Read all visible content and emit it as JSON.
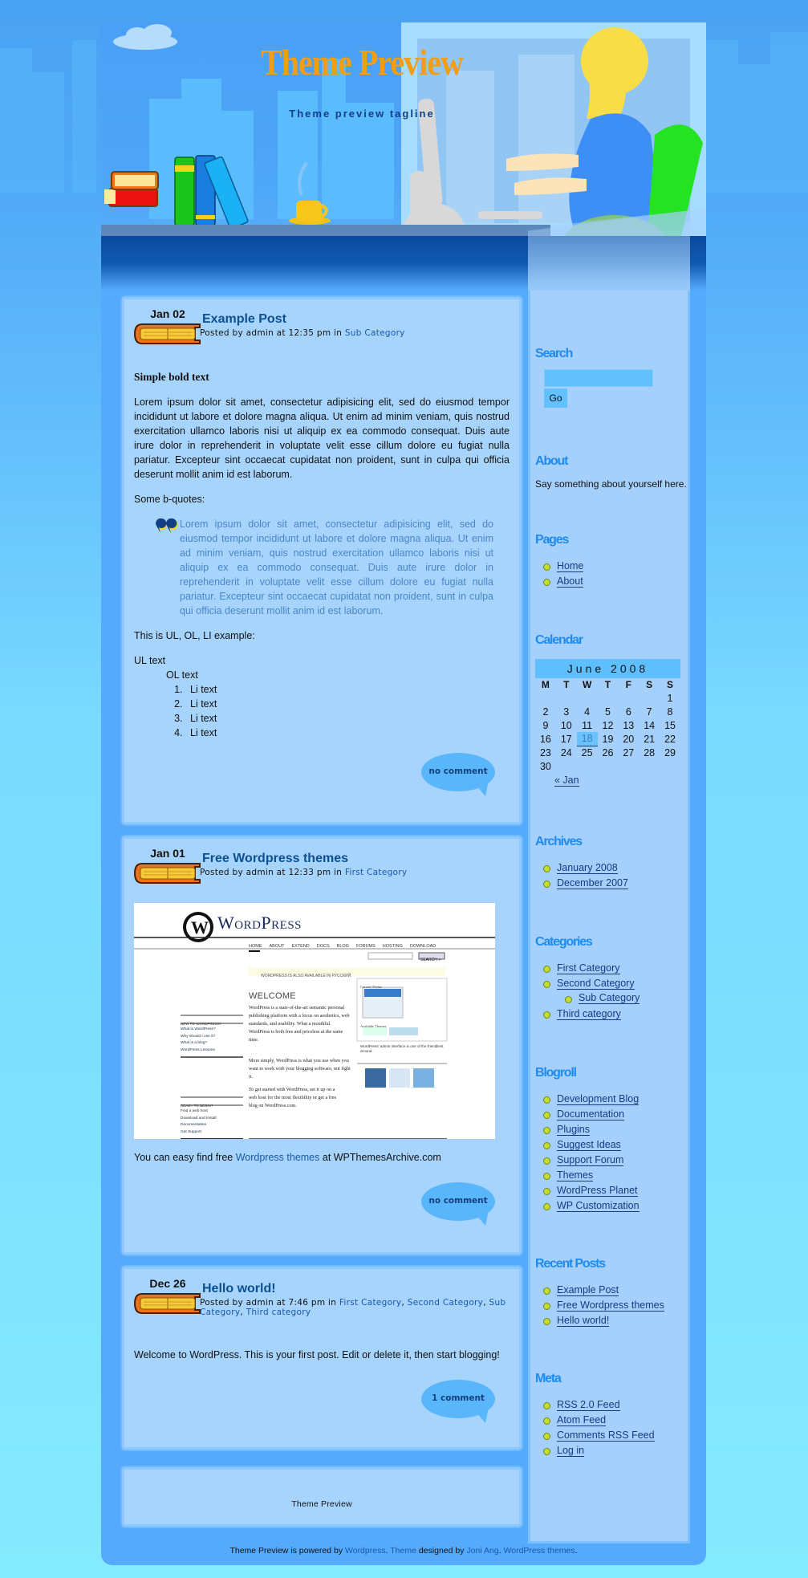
{
  "header": {
    "title": "Theme Preview",
    "tagline": "Theme preview tagline"
  },
  "posts": [
    {
      "date": "Jan 02",
      "title": "Example Post",
      "meta_prefix": "Posted by admin at 12:35 pm in ",
      "categories": [
        "Sub Category"
      ],
      "bold_heading": "Simple bold text",
      "paragraph": "Lorem ipsum dolor sit amet, consectetur adipisicing elit, sed do eiusmod tempor incididunt ut labore et dolore magna aliqua. Ut enim ad minim veniam, quis nostrud exercitation ullamco laboris nisi ut aliquip ex ea commodo consequat. Duis aute irure dolor in reprehenderit in voluptate velit esse cillum dolore eu fugiat nulla pariatur. Excepteur sint occaecat cupidatat non proident, sunt in culpa qui officia deserunt mollit anim id est laborum.",
      "bquote_intro": "Some b-quotes:",
      "blockquote": "Lorem ipsum dolor sit amet, consectetur adipisicing elit, sed do eiusmod tempor incididunt ut labore et dolore magna aliqua. Ut enim ad minim veniam, quis nostrud exercitation ullamco laboris nisi ut aliquip ex ea commodo consequat. Duis aute irure dolor in reprehenderit in voluptate velit esse cillum dolore eu fugiat nulla pariatur. Excepteur sint occaecat cupidatat non proident, sunt in culpa qui officia deserunt mollit anim id est laborum.",
      "list_intro": "This is UL, OL, LI example:",
      "ul_text": "UL text",
      "ol_text": "OL text",
      "li_items": [
        "Li text",
        "Li text",
        "Li text",
        "Li text"
      ],
      "comments": "no comment"
    },
    {
      "date": "Jan 01",
      "title": "Free Wordpress themes",
      "meta_prefix": "Posted by admin at 12:33 pm in ",
      "categories": [
        "First Category"
      ],
      "image": {
        "logo_text": "WordPress",
        "nav": [
          "HOME",
          "ABOUT",
          "EXTEND",
          "DOCS",
          "BLOG",
          "FORUMS",
          "HOSTING",
          "DOWNLOAD"
        ],
        "search_button": "SEARCH »",
        "notice": "WORDPRESS IS ALSO AVAILABLE IN РУССКИЙ.",
        "welcome": "WELCOME",
        "new_heading": "NEW TO WORDPRESS?",
        "new_links": [
          "What is WordPress?",
          "Why should I use it?",
          "What is a blog?",
          "WordPress Lessons"
        ],
        "begin_heading": "READY TO BEGIN?",
        "begin_links": [
          "Find a web host",
          "Download and Install",
          "Documentation",
          "Get Support"
        ],
        "para1": "WordPress is a state-of-the-art semantic personal publishing platform with a focus on aesthetics, web standards, and usability. What a mouthful. WordPress is both free and priceless at the same time.",
        "para2": "More simply, WordPress is what you use when you want to work with your blogging software, not fight it.",
        "para3": "To get started with WordPress, set it up on a web host for the most flexibility or get a free blog on WordPress.com.",
        "current_theme": "Current Theme",
        "available_themes": "Available Themes",
        "caption": "WordPress' admin interface is one of the friendliest around."
      },
      "text_before": "You can easy find free ",
      "link_text": "Wordpress themes",
      "text_after": " at WPThemesArchive.com",
      "comments": "no comment"
    },
    {
      "date": "Dec 26",
      "title": "Hello world!",
      "meta_prefix": "Posted by admin at 7:46 pm in ",
      "categories": [
        "First Category",
        "Second Category",
        "Sub Category",
        "Third category"
      ],
      "paragraph": "Welcome to WordPress. This is your first post. Edit or delete it, then start blogging!",
      "comments": "1 comment"
    }
  ],
  "footer_box": {
    "label": "Theme Preview"
  },
  "credits": {
    "prefix": "Theme Preview is powered by ",
    "wordpress": "Wordpress",
    "sep1": ". ",
    "theme": "Theme",
    "designed": " designed by ",
    "author": "Joni Ang",
    "sep2": ". ",
    "themes_link": "WordPress themes",
    "end": "."
  },
  "sidebar": {
    "search": {
      "title": "Search",
      "input_value": "",
      "button": "Go"
    },
    "about": {
      "title": "About",
      "text": "Say something about yourself here."
    },
    "pages": {
      "title": "Pages",
      "items": [
        "Home",
        "About"
      ]
    },
    "calendar": {
      "title": "Calendar",
      "caption": "June 2008",
      "weekdays": [
        "M",
        "T",
        "W",
        "T",
        "F",
        "S",
        "S"
      ],
      "weeks": [
        [
          "",
          "",
          "",
          "",
          "",
          "",
          "1"
        ],
        [
          "2",
          "3",
          "4",
          "5",
          "6",
          "7",
          "8"
        ],
        [
          "9",
          "10",
          "11",
          "12",
          "13",
          "14",
          "15"
        ],
        [
          "16",
          "17",
          "18",
          "19",
          "20",
          "21",
          "22"
        ],
        [
          "23",
          "24",
          "25",
          "26",
          "27",
          "28",
          "29"
        ],
        [
          "30",
          "",
          "",
          "",
          "",
          "",
          ""
        ]
      ],
      "today": "18",
      "prev_link": "« Jan"
    },
    "archives": {
      "title": "Archives",
      "items": [
        "January 2008",
        "December 2007"
      ]
    },
    "categories": {
      "title": "Categories",
      "items": [
        "First Category",
        "Second Category",
        "Third category"
      ],
      "sub_items": [
        "Sub Category"
      ]
    },
    "blogroll": {
      "title": "Blogroll",
      "items": [
        "Development Blog",
        "Documentation",
        "Plugins",
        "Suggest Ideas",
        "Support Forum",
        "Themes",
        "WordPress Planet",
        "WP Customization"
      ]
    },
    "recent_posts": {
      "title": "Recent Posts",
      "items": [
        "Example Post",
        "Free Wordpress themes",
        "Hello world!"
      ]
    },
    "meta": {
      "title": "Meta",
      "items": [
        "RSS 2.0 Feed",
        "Atom Feed",
        "Comments RSS Feed",
        "Log in"
      ]
    }
  }
}
